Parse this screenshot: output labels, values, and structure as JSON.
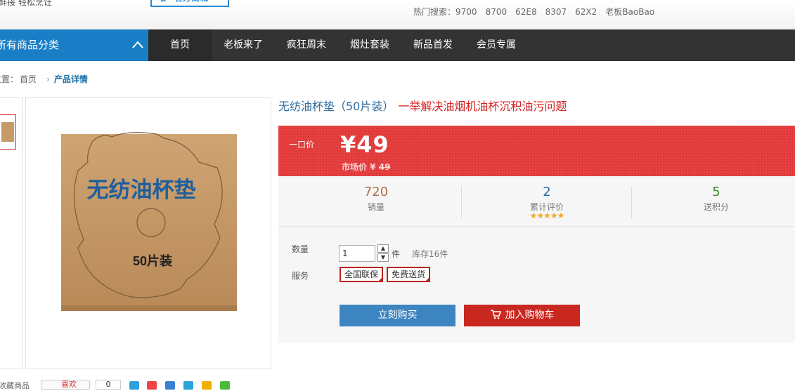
{
  "header": {
    "tagline": "鲜接 轻松烹饪",
    "box_text": "唯一官方商城",
    "hot_search_label": "热门搜索：",
    "hot_search": [
      "9700",
      "8700",
      "62E8",
      "8307",
      "62X2",
      "老板BaoBao"
    ]
  },
  "nav": {
    "category_label": "所有商品分类",
    "items": [
      "首页",
      "老板来了",
      "疯狂周末",
      "烟灶套装",
      "新品首发",
      "会员专属"
    ]
  },
  "breadcrumb": {
    "prefix": "位置：",
    "home": "首页",
    "current": "产品详情"
  },
  "product": {
    "name": "无纺油杯垫（50片装）",
    "subtitle": "一举解决油烟机油杯沉积油污问题",
    "image_text_main": "无纺油杯垫",
    "image_text_sub": "50片装",
    "price_label": "一口价",
    "price": "¥49",
    "market_price_label": "市场价 ¥",
    "market_price": "49"
  },
  "stats": [
    {
      "value": "720",
      "label": "销量",
      "color": "#b0704a"
    },
    {
      "value": "2",
      "label": "累计评价",
      "color": "#2e6a9c"
    },
    {
      "value": "5",
      "label": "送积分",
      "color": "#3a8a2a"
    }
  ],
  "rating_stars": "★★★★★",
  "purchase": {
    "qty_label": "数量",
    "qty_value": "1",
    "unit": "件",
    "stock": "库存16件",
    "service_label": "服务",
    "services": [
      "全国联保",
      "免费送货"
    ],
    "buy_now": "立刻购买",
    "add_to_cart": "加入购物车"
  },
  "share": {
    "collect_label": "收藏商品",
    "like_label": "喜欢",
    "like_count": "0"
  },
  "colors": {
    "nav_bg": "#333333",
    "category_bg": "#1a7ec6",
    "price_bg": "#e23a3a",
    "buy_now_bg": "#3d85c0",
    "add_cart_bg": "#c8281f"
  }
}
